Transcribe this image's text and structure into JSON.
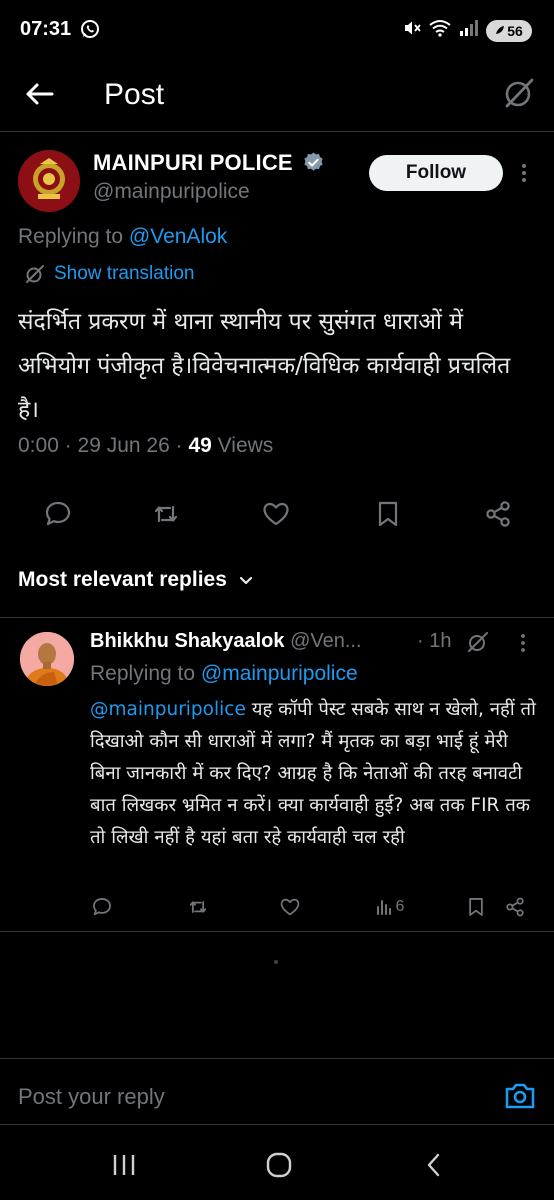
{
  "status_bar": {
    "time": "07:31",
    "battery": "56",
    "icons": [
      "whatsapp-icon",
      "mute-icon",
      "wifi-icon",
      "signal-icon",
      "battery-icon"
    ]
  },
  "header": {
    "title": "Post",
    "back_icon": "arrow-left-icon",
    "grok_icon": "grok-icon"
  },
  "post": {
    "author_name": "MAINPURI POLICE",
    "author_handle": "@mainpuripolice",
    "follow_label": "Follow",
    "replying_label": "Replying to",
    "replying_handle": "@VenAlok",
    "show_translation": "Show translation",
    "text": "संदर्भित प्रकरण में थाना स्थानीय पर सुसंगत धाराओं में अभियोग पंजीकृत है।विवेचनात्मक/विधिक कार्यवाही प्रचलित है।",
    "time": "0:00",
    "date": "29 Jun 26",
    "views_count": "49",
    "views_label": "Views"
  },
  "most_relevant_label": "Most relevant replies",
  "reply": {
    "author_name": "Bhikkhu Shakyaalok",
    "author_handle": "@Ven...",
    "time": "· 1h",
    "replying_label": "Replying to",
    "replying_handle": "@mainpuripolice",
    "mention": "@mainpuripolice",
    "text": " यह कॉपी पेस्ट सबके साथ न खेलो,  नहीं तो दिखाओ कौन सी धाराओं में लगा? मैं मृतक का बड़ा भाई हूं मेरी बिना जानकारी में कर दिए? आग्रह है कि नेताओं की तरह बनावटी बात लिखकर भ्रमित न करें। क्या कार्यवाही हुई? अब तक FIR तक तो लिखी नहीं है यहां बता रहे कार्यवाही चल रही",
    "views": "6"
  },
  "compose": {
    "placeholder": "Post your reply"
  },
  "colors": {
    "background": "#000000",
    "text": "#e7e9ea",
    "muted": "#71767b",
    "accent_blue": "#1d9bf0",
    "divider": "#2f3336",
    "verified_badge": "#829aab"
  }
}
